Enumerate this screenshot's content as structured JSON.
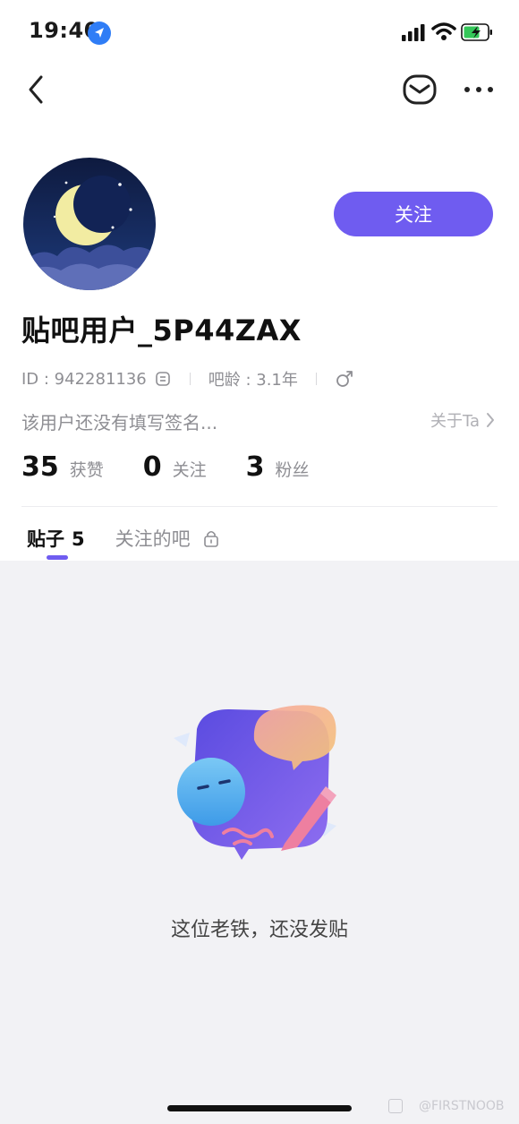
{
  "status_bar": {
    "time": "19:40"
  },
  "profile": {
    "follow_label": "关注",
    "username": "贴吧用户_5P44ZAX",
    "id_text": "ID : 942281136",
    "age_text": "吧龄 : 3.1年",
    "bio": "该用户还没有填写签名...",
    "about_label": "关于Ta",
    "stats": [
      {
        "num": "35",
        "label": "获赞"
      },
      {
        "num": "0",
        "label": "关注"
      },
      {
        "num": "3",
        "label": "粉丝"
      }
    ]
  },
  "tabs": {
    "posts_label": "贴子",
    "posts_count": "5",
    "bars_label": "关注的吧"
  },
  "empty_state": {
    "text": "这位老铁，还没发贴"
  },
  "watermark": "@FIRSTNOOB",
  "colors": {
    "accent": "#6f5cf0",
    "background": "#f2f2f5"
  }
}
